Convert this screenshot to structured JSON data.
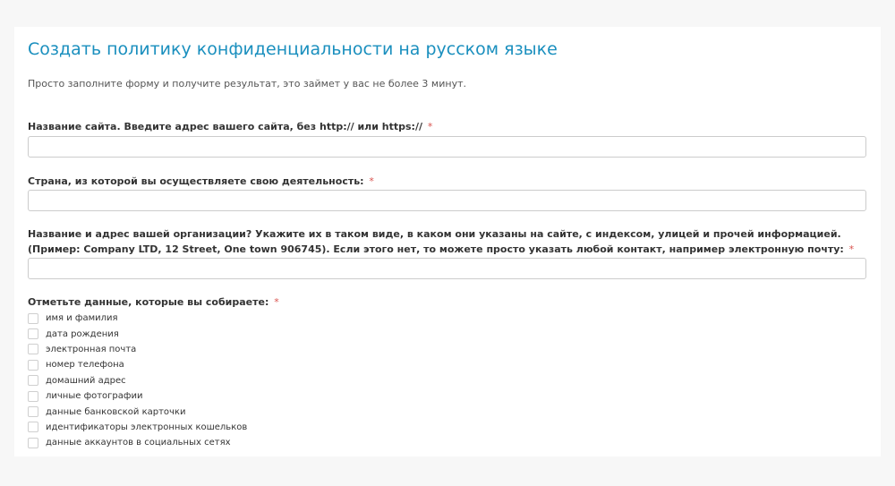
{
  "page": {
    "title": "Создать политику конфиденциальности на русском языке",
    "subtitle": "Просто заполните форму и получите результат, это займет у вас не более 3 минут."
  },
  "fields": {
    "site": {
      "label": "Название сайта. Введите адрес вашего сайта, без http:// или https://",
      "required_mark": "*",
      "value": ""
    },
    "country": {
      "label": "Страна, из которой вы осуществляете свою деятельность:",
      "required_mark": "*",
      "value": ""
    },
    "organization": {
      "label": "Название и адрес вашей организации? Укажите их в таком виде, в каком они указаны на сайте, с индексом, улицей и прочей информацией. (Пример: Company LTD, 12 Street, One town 906745). Если этого нет, то можете просто указать любой контакт, например электронную почту:",
      "required_mark": "*",
      "value": ""
    }
  },
  "collected_data": {
    "label": "Отметьте данные, которые вы собираете:",
    "required_mark": "*",
    "options": [
      {
        "label": "имя и фамилия",
        "checked": false
      },
      {
        "label": "дата рождения",
        "checked": false
      },
      {
        "label": "электронная почта",
        "checked": false
      },
      {
        "label": "номер телефона",
        "checked": false
      },
      {
        "label": "домашний адрес",
        "checked": false
      },
      {
        "label": "личные фотографии",
        "checked": false
      },
      {
        "label": "данные банковской карточки",
        "checked": false
      },
      {
        "label": "идентификаторы электронных кошельков",
        "checked": false
      },
      {
        "label": "данные аккаунтов в социальных сетях",
        "checked": false
      }
    ]
  },
  "colors": {
    "title": "#1a8fbe",
    "required": "#d9534f",
    "input_border": "#cccccc"
  }
}
